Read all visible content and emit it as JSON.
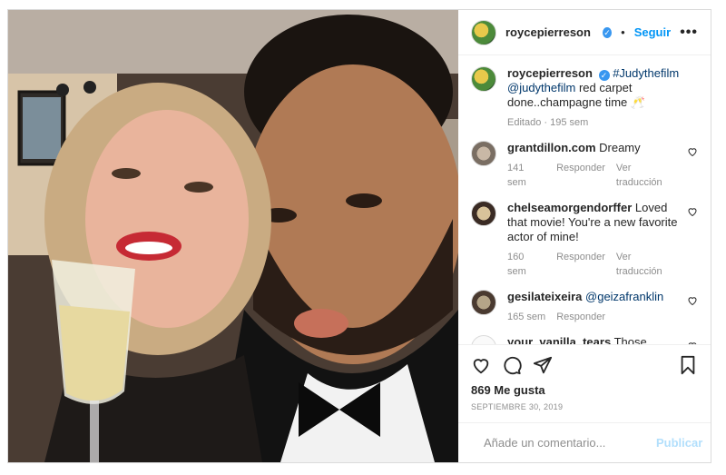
{
  "header": {
    "username": "roycepierreson",
    "verified_icon": "verified-badge-icon",
    "separator": "•",
    "follow_label": "Seguir",
    "more_label": "•••"
  },
  "caption": {
    "username": "roycepierreson",
    "hashtag": "#Judythefilm",
    "mention": "@judythefilm",
    "text": "red carpet done..champagne time 🥂",
    "meta": "Editado · 195 sem"
  },
  "comments": [
    {
      "username": "grantdillon.com",
      "text": "Dreamy",
      "time": "141 sem",
      "reply": "Responder",
      "translate": "Ver traducción"
    },
    {
      "username": "chelseamorgendorffer",
      "text": "Loved that movie! You're a new favorite actor of mine!",
      "time": "160 sem",
      "reply": "Responder",
      "translate": "Ver traducción"
    },
    {
      "username": "gesilateixeira",
      "mention": "@geizafranklin",
      "time": "165 sem",
      "reply": "Responder"
    },
    {
      "username": "your_vanilla_tears",
      "text": "Those magic eyes)))"
    }
  ],
  "likes": "869 Me gusta",
  "date": "Septiembre 30, 2019",
  "add_comment": {
    "placeholder": "Añade un comentario...",
    "publish_label": "Publicar"
  },
  "colors": {
    "accent": "#0095f6",
    "verified": "#3897f0",
    "muted": "#8e8e8e",
    "publish_disabled": "#b2dffc"
  }
}
